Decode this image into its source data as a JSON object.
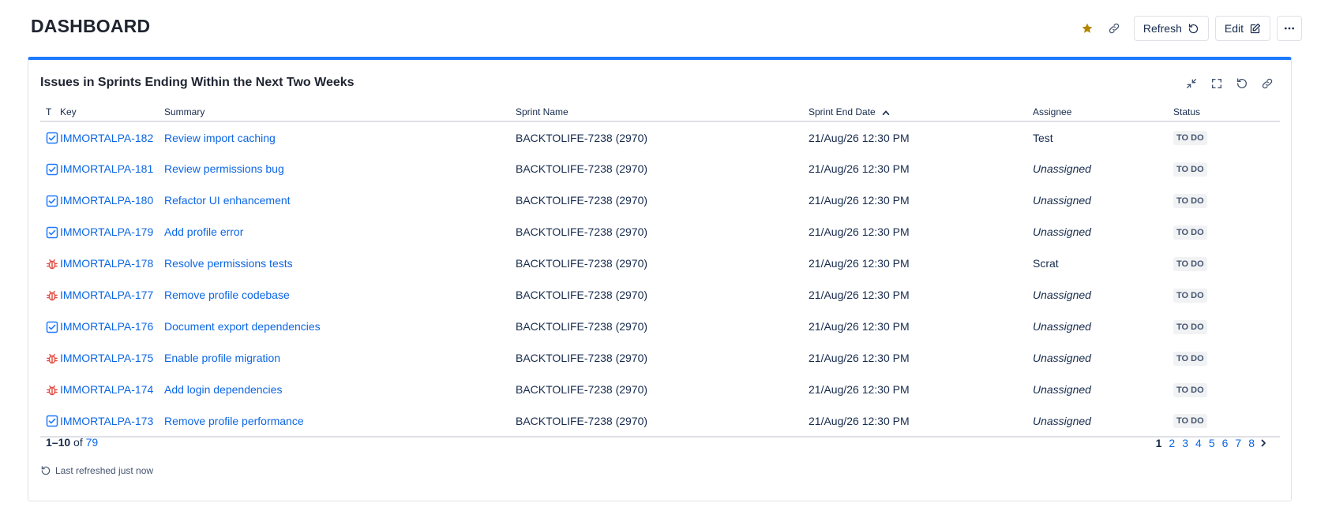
{
  "page": {
    "title": "DASHBOARD"
  },
  "header": {
    "refresh_label": "Refresh",
    "edit_label": "Edit"
  },
  "gadget": {
    "title": "Issues in Sprints Ending Within the Next Two Weeks",
    "columns": {
      "type": "T",
      "key": "Key",
      "summary": "Summary",
      "sprint": "Sprint Name",
      "end_date": "Sprint End Date",
      "assignee": "Assignee",
      "status": "Status"
    },
    "rows": [
      {
        "type": "task",
        "key": "IMMORTALPA-182",
        "summary": "Review import caching",
        "sprint": "BACKTOLIFE-7238 (2970)",
        "end_date": "21/Aug/26 12:30 PM",
        "assignee": "Test",
        "unassigned": false,
        "status": "TO DO"
      },
      {
        "type": "task",
        "key": "IMMORTALPA-181",
        "summary": "Review permissions bug",
        "sprint": "BACKTOLIFE-7238 (2970)",
        "end_date": "21/Aug/26 12:30 PM",
        "assignee": "Unassigned",
        "unassigned": true,
        "status": "TO DO"
      },
      {
        "type": "task",
        "key": "IMMORTALPA-180",
        "summary": "Refactor UI enhancement",
        "sprint": "BACKTOLIFE-7238 (2970)",
        "end_date": "21/Aug/26 12:30 PM",
        "assignee": "Unassigned",
        "unassigned": true,
        "status": "TO DO"
      },
      {
        "type": "task",
        "key": "IMMORTALPA-179",
        "summary": "Add profile error",
        "sprint": "BACKTOLIFE-7238 (2970)",
        "end_date": "21/Aug/26 12:30 PM",
        "assignee": "Unassigned",
        "unassigned": true,
        "status": "TO DO"
      },
      {
        "type": "bug",
        "key": "IMMORTALPA-178",
        "summary": "Resolve permissions tests",
        "sprint": "BACKTOLIFE-7238 (2970)",
        "end_date": "21/Aug/26 12:30 PM",
        "assignee": "Scrat",
        "unassigned": false,
        "status": "TO DO"
      },
      {
        "type": "bug",
        "key": "IMMORTALPA-177",
        "summary": "Remove profile codebase",
        "sprint": "BACKTOLIFE-7238 (2970)",
        "end_date": "21/Aug/26 12:30 PM",
        "assignee": "Unassigned",
        "unassigned": true,
        "status": "TO DO"
      },
      {
        "type": "task",
        "key": "IMMORTALPA-176",
        "summary": "Document export dependencies",
        "sprint": "BACKTOLIFE-7238 (2970)",
        "end_date": "21/Aug/26 12:30 PM",
        "assignee": "Unassigned",
        "unassigned": true,
        "status": "TO DO"
      },
      {
        "type": "bug",
        "key": "IMMORTALPA-175",
        "summary": "Enable profile migration",
        "sprint": "BACKTOLIFE-7238 (2970)",
        "end_date": "21/Aug/26 12:30 PM",
        "assignee": "Unassigned",
        "unassigned": true,
        "status": "TO DO"
      },
      {
        "type": "bug",
        "key": "IMMORTALPA-174",
        "summary": "Add login dependencies",
        "sprint": "BACKTOLIFE-7238 (2970)",
        "end_date": "21/Aug/26 12:30 PM",
        "assignee": "Unassigned",
        "unassigned": true,
        "status": "TO DO"
      },
      {
        "type": "task",
        "key": "IMMORTALPA-173",
        "summary": "Remove profile performance",
        "sprint": "BACKTOLIFE-7238 (2970)",
        "end_date": "21/Aug/26 12:30 PM",
        "assignee": "Unassigned",
        "unassigned": true,
        "status": "TO DO"
      }
    ],
    "pagination": {
      "range": "1–10",
      "of_label": "of",
      "total": "79",
      "pages": [
        "1",
        "2",
        "3",
        "4",
        "5",
        "6",
        "7",
        "8"
      ],
      "current_page": "1"
    },
    "last_refreshed": "Last refreshed just now"
  },
  "icons": {
    "star": "star-icon",
    "link": "link-icon",
    "refresh": "refresh-icon",
    "edit": "edit-icon",
    "more": "more-icon",
    "minimize": "minimize-icon",
    "fullscreen": "fullscreen-icon",
    "task": "task-icon",
    "bug": "bug-icon"
  },
  "colors": {
    "accent": "#1d7afc",
    "link": "#0c66e4",
    "star": "#b38600",
    "task": "#1d7afc",
    "bug": "#e2483d",
    "lozenge_bg": "#f1f2f4"
  }
}
